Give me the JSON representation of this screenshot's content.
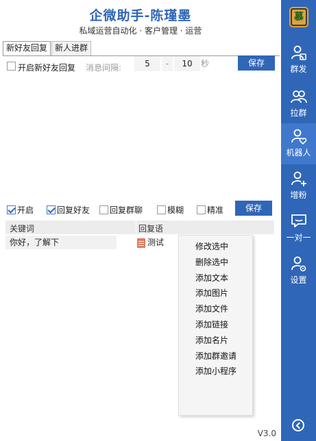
{
  "header": {
    "title": "企微助手-陈瑾墨",
    "subtitle": "私域运营自动化 · 客户管理 · 运营"
  },
  "tabs": [
    {
      "label": "新好友回复",
      "active": true
    },
    {
      "label": "新人进群",
      "active": false
    }
  ],
  "new_friend": {
    "enable_label": "开启新好友回复",
    "enabled": false,
    "interval_label": "消息间隔:",
    "interval_min": "5",
    "dash": "-",
    "interval_max": "10",
    "unit": "秒",
    "save_label": "保存"
  },
  "robot": {
    "options": [
      {
        "label": "开启",
        "checked": true
      },
      {
        "label": "回复好友",
        "checked": true
      },
      {
        "label": "回复群聊",
        "checked": false
      },
      {
        "label": "模糊",
        "checked": false
      },
      {
        "label": "精准",
        "checked": false
      }
    ],
    "save_label": "保存"
  },
  "table": {
    "headers": [
      "关键词",
      "回复语"
    ],
    "rows": [
      {
        "keyword": "你好，了解下",
        "reply": "测试",
        "reply_icon": "file-icon"
      }
    ]
  },
  "context_menu": {
    "items": [
      "修改选中",
      "删除选中",
      "添加文本",
      "添加图片",
      "添加文件",
      "添加链接",
      "添加名片",
      "添加群邀请",
      "添加小程序"
    ]
  },
  "version": "V3.0",
  "sidebar": {
    "logo_char": "慕",
    "items": [
      {
        "label": "群发",
        "icon": "user-group-icon",
        "active": false
      },
      {
        "label": "拉群",
        "icon": "users-icon",
        "active": false
      },
      {
        "label": "机器人",
        "icon": "user-heart-icon",
        "active": true
      },
      {
        "label": "增粉",
        "icon": "user-add-icon",
        "active": false
      },
      {
        "label": "一对一",
        "icon": "chat-icon",
        "active": false
      },
      {
        "label": "设置",
        "icon": "user-settings-icon",
        "active": false
      }
    ],
    "colors": {
      "accent": "#2f66b7",
      "active": "#3f78cc"
    }
  }
}
